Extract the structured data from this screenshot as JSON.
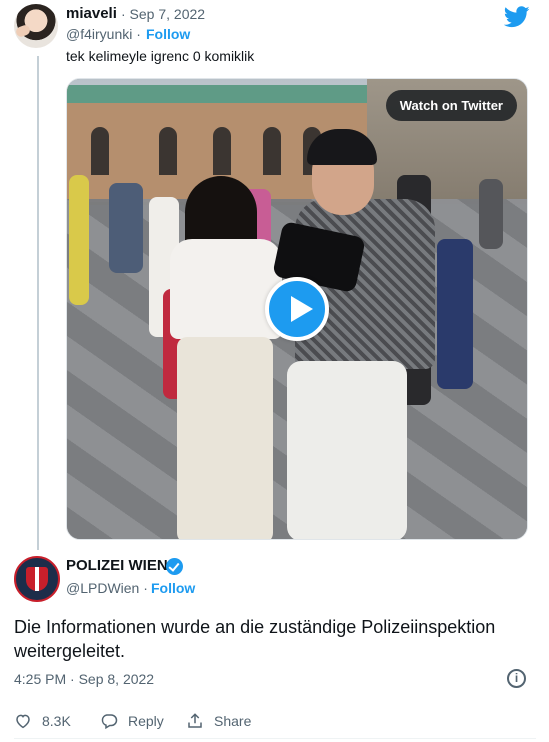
{
  "parent_tweet": {
    "name": "miaveli",
    "date": "· Sep 7, 2022",
    "handle": "@f4iryunki ·",
    "follow_label": "Follow",
    "text": "tek kelimeyle igrenc 0 komiklik"
  },
  "video": {
    "watch_label": "Watch on Twitter",
    "play_icon": "play-icon"
  },
  "main_tweet": {
    "name": "POLIZEI WIEN",
    "handle": "@LPDWien ·",
    "follow_label": "Follow",
    "text": "Die Informationen wurde an die zuständige Polizeiinspektion weitergeleitet.",
    "timestamp": "4:25 PM · Sep 8, 2022",
    "info_icon": "i"
  },
  "actions": {
    "like_count": "8.3K",
    "reply_label": "Reply",
    "share_label": "Share"
  },
  "colors": {
    "accent": "#1d9bf0",
    "secondary_text": "#536471",
    "like_red": "#f91880"
  }
}
